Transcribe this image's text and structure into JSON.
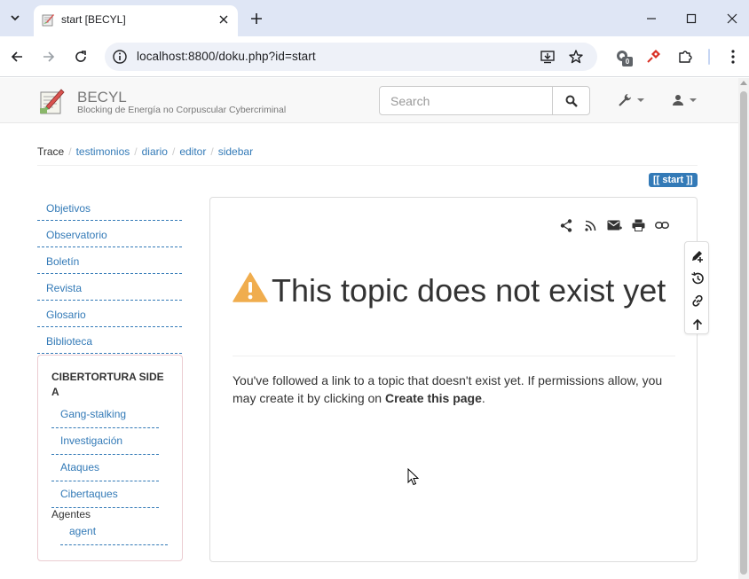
{
  "browser": {
    "tab_title": "start [BECYL]",
    "url": "localhost:8800/doku.php?id=start",
    "extension_badge": "0"
  },
  "site": {
    "title": "BECYL",
    "tagline": "Blocking de Energía no Corpuscular Cybercriminal",
    "search_placeholder": "Search"
  },
  "breadcrumb": {
    "label": "Trace",
    "items": [
      "testimonios",
      "diario",
      "editor",
      "sidebar"
    ]
  },
  "page_badge": "[[ start ]]",
  "sidebar": {
    "links": [
      "Objetivos",
      "Observatorio",
      "Boletín",
      "Revista",
      "Glosario",
      "Biblioteca"
    ],
    "panel": {
      "heading": "CIBERTORTURA SIDE A",
      "links": [
        "Gang-stalking",
        "Investigación",
        "Ataques",
        "Cibertaques"
      ],
      "subheading": "Agentes",
      "sublinks": [
        "agent"
      ]
    }
  },
  "content": {
    "heading": "This topic does not exist yet",
    "body_prefix": "You've followed a link to a topic that doesn't exist yet. If permissions allow, you may create it by clicking on ",
    "body_action": "Create this page",
    "body_suffix": "."
  },
  "colors": {
    "link": "#337ab7",
    "warning": "#f0ad4e",
    "badge": "#337ab7"
  }
}
